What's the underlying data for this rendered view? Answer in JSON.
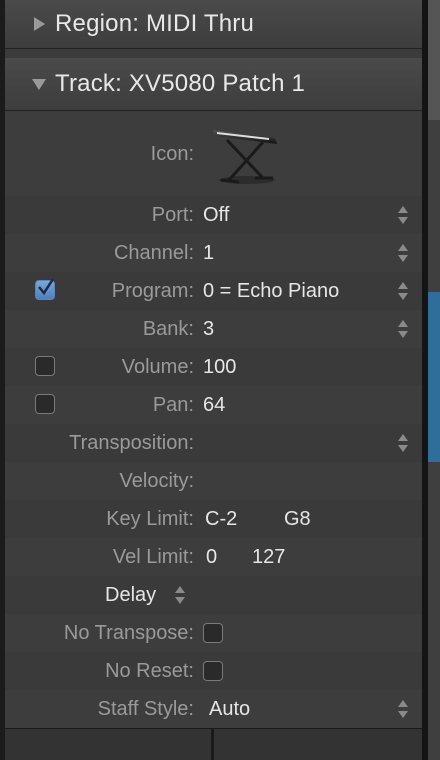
{
  "region": {
    "title": "Region:  MIDI Thru"
  },
  "track": {
    "title": "Track:  XV5080 Patch 1"
  },
  "rows": {
    "icon": {
      "label": "Icon:",
      "icon_name": "keyboard-stand-icon"
    },
    "port": {
      "label": "Port:",
      "value": "Off"
    },
    "channel": {
      "label": "Channel:",
      "value": "1"
    },
    "program": {
      "label": "Program:",
      "value": "0 = Echo Piano",
      "checked": true
    },
    "bank": {
      "label": "Bank:",
      "value": "3"
    },
    "volume": {
      "label": "Volume:",
      "value": "100",
      "checked": false
    },
    "pan": {
      "label": "Pan:",
      "value": "64",
      "checked": false
    },
    "transposition": {
      "label": "Transposition:",
      "value": ""
    },
    "velocity": {
      "label": "Velocity:",
      "value": ""
    },
    "key_limit": {
      "label": "Key Limit:",
      "low": "C-2",
      "high": "G8"
    },
    "vel_limit": {
      "label": "Vel Limit:",
      "low": "0",
      "high": "127"
    },
    "delay": {
      "label": "Delay"
    },
    "no_transpose": {
      "label": "No Transpose:",
      "checked": false
    },
    "no_reset": {
      "label": "No Reset:",
      "checked": false
    },
    "staff_style": {
      "label": "Staff Style:",
      "value": "Auto"
    }
  },
  "colors": {
    "accent": "#4f7fbd",
    "label": "#9a9a9a",
    "value": "#e6e6e6",
    "background": "#3a3a3a"
  }
}
